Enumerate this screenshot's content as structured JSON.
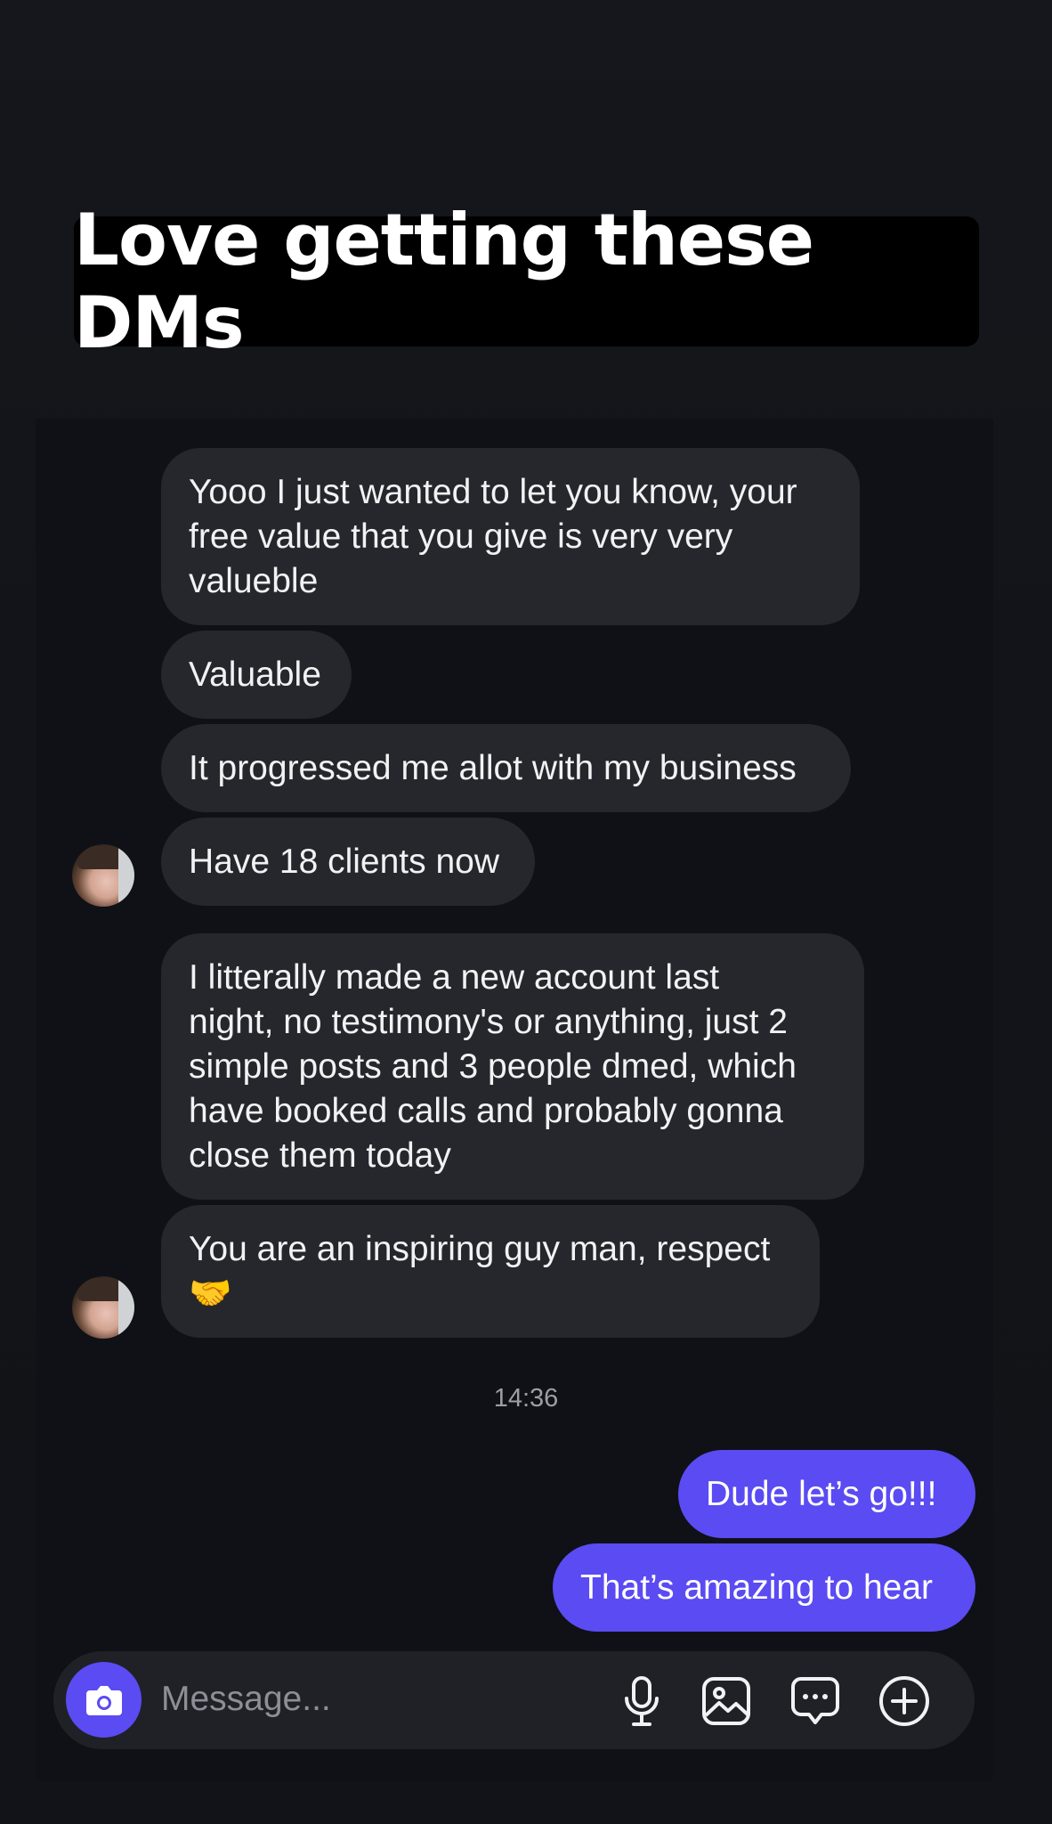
{
  "story": {
    "title": "Love getting these DMs"
  },
  "messages": {
    "m1": "Yooo I just wanted to let you know, your\nfree value that you give is very very\nvalueble",
    "m2": "Valuable",
    "m3": "It progressed me allot with my business",
    "m4": "Have 18 clients now",
    "m5": "I litterally made a new account last\nnight, no testimony's or anything, just 2\nsimple posts and 3 people dmed, which\nhave booked calls and probably gonna\nclose them today",
    "m6": "You are an inspiring guy man, respect\n🤝",
    "timestamp": "14:36",
    "out1": "Dude let’s go!!!",
    "out2": "That’s amazing to hear"
  },
  "composer": {
    "placeholder": "Message...",
    "icons": [
      "camera-icon",
      "microphone-icon",
      "gallery-icon",
      "sticker-icon",
      "plus-icon"
    ]
  },
  "colors": {
    "background": "#121419",
    "incoming_bubble": "#26272c",
    "outgoing_bubble": "#5b4bf2",
    "accent": "#5b4bf2"
  }
}
